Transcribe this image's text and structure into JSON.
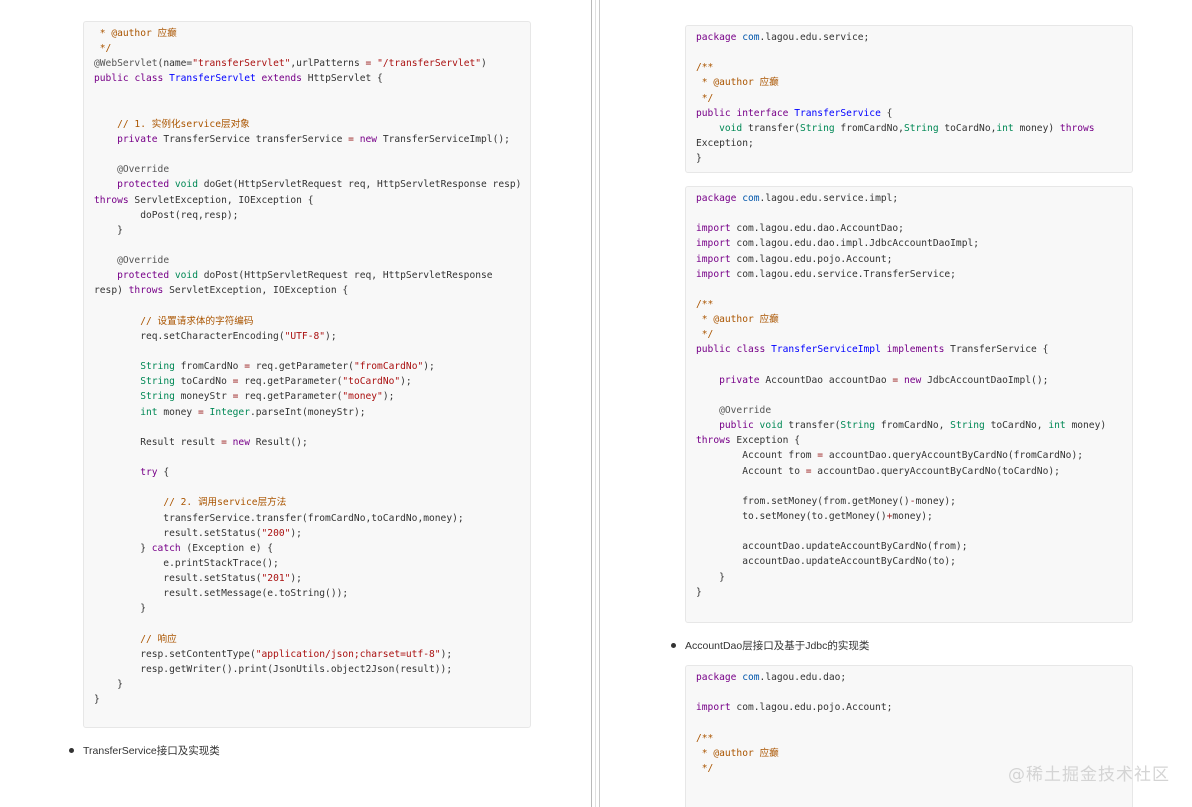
{
  "left_page": {
    "code_block": {
      "lines": [
        [
          [
            " * @author 应癫",
            "cmt"
          ]
        ],
        [
          [
            " */",
            "cmt"
          ]
        ],
        [
          [
            "@WebServlet",
            "ann"
          ],
          [
            "(name=",
            "plain"
          ],
          [
            "\"transferServlet\"",
            "str"
          ],
          [
            ",urlPatterns ",
            "plain"
          ],
          [
            "=",
            "op"
          ],
          [
            " ",
            "plain"
          ],
          [
            "\"/transferServlet\"",
            "str"
          ],
          [
            ")",
            "plain"
          ]
        ],
        [
          [
            "public",
            "kw"
          ],
          [
            " ",
            "plain"
          ],
          [
            "class",
            "kw"
          ],
          [
            " ",
            "plain"
          ],
          [
            "TransferServlet",
            "cls"
          ],
          [
            " ",
            "plain"
          ],
          [
            "extends",
            "kw"
          ],
          [
            " HttpServlet {",
            "plain"
          ]
        ],
        [
          [
            "",
            "plain"
          ]
        ],
        [
          [
            "",
            "plain"
          ]
        ],
        [
          [
            "    ",
            "plain"
          ],
          [
            "// 1. 实例化service层对象",
            "cmt"
          ]
        ],
        [
          [
            "    ",
            "plain"
          ],
          [
            "private",
            "kw"
          ],
          [
            " TransferService transferService ",
            "plain"
          ],
          [
            "=",
            "op"
          ],
          [
            " ",
            "plain"
          ],
          [
            "new",
            "kw"
          ],
          [
            " TransferServiceImpl();",
            "plain"
          ]
        ],
        [
          [
            "",
            "plain"
          ]
        ],
        [
          [
            "    ",
            "plain"
          ],
          [
            "@Override",
            "ann"
          ]
        ],
        [
          [
            "    ",
            "plain"
          ],
          [
            "protected",
            "kw"
          ],
          [
            " ",
            "plain"
          ],
          [
            "void",
            "tp"
          ],
          [
            " doGet(HttpServletRequest req, HttpServletResponse resp)",
            "plain"
          ]
        ],
        [
          [
            "throws",
            "kw"
          ],
          [
            " ServletException, IOException {",
            "plain"
          ]
        ],
        [
          [
            "        doPost(req,resp);",
            "plain"
          ]
        ],
        [
          [
            "    }",
            "plain"
          ]
        ],
        [
          [
            "",
            "plain"
          ]
        ],
        [
          [
            "    ",
            "plain"
          ],
          [
            "@Override",
            "ann"
          ]
        ],
        [
          [
            "    ",
            "plain"
          ],
          [
            "protected",
            "kw"
          ],
          [
            " ",
            "plain"
          ],
          [
            "void",
            "tp"
          ],
          [
            " doPost(HttpServletRequest req, HttpServletResponse",
            "plain"
          ]
        ],
        [
          [
            "resp) ",
            "plain"
          ],
          [
            "throws",
            "kw"
          ],
          [
            " ServletException, IOException {",
            "plain"
          ]
        ],
        [
          [
            "",
            "plain"
          ]
        ],
        [
          [
            "        ",
            "plain"
          ],
          [
            "// 设置请求体的字符编码",
            "cmt"
          ]
        ],
        [
          [
            "        req.setCharacterEncoding(",
            "plain"
          ],
          [
            "\"UTF-8\"",
            "str"
          ],
          [
            ");",
            "plain"
          ]
        ],
        [
          [
            "",
            "plain"
          ]
        ],
        [
          [
            "        ",
            "plain"
          ],
          [
            "String",
            "tp"
          ],
          [
            " fromCardNo ",
            "plain"
          ],
          [
            "=",
            "op"
          ],
          [
            " req.getParameter(",
            "plain"
          ],
          [
            "\"fromCardNo\"",
            "str"
          ],
          [
            ");",
            "plain"
          ]
        ],
        [
          [
            "        ",
            "plain"
          ],
          [
            "String",
            "tp"
          ],
          [
            " toCardNo ",
            "plain"
          ],
          [
            "=",
            "op"
          ],
          [
            " req.getParameter(",
            "plain"
          ],
          [
            "\"toCardNo\"",
            "str"
          ],
          [
            ");",
            "plain"
          ]
        ],
        [
          [
            "        ",
            "plain"
          ],
          [
            "String",
            "tp"
          ],
          [
            " moneyStr ",
            "plain"
          ],
          [
            "=",
            "op"
          ],
          [
            " req.getParameter(",
            "plain"
          ],
          [
            "\"money\"",
            "str"
          ],
          [
            ");",
            "plain"
          ]
        ],
        [
          [
            "        ",
            "plain"
          ],
          [
            "int",
            "tp"
          ],
          [
            " money ",
            "plain"
          ],
          [
            "=",
            "op"
          ],
          [
            " ",
            "plain"
          ],
          [
            "Integer",
            "tp"
          ],
          [
            ".parseInt(moneyStr);",
            "plain"
          ]
        ],
        [
          [
            "",
            "plain"
          ]
        ],
        [
          [
            "        Result result ",
            "plain"
          ],
          [
            "=",
            "op"
          ],
          [
            " ",
            "plain"
          ],
          [
            "new",
            "kw"
          ],
          [
            " Result();",
            "plain"
          ]
        ],
        [
          [
            "",
            "plain"
          ]
        ],
        [
          [
            "        ",
            "plain"
          ],
          [
            "try",
            "kw"
          ],
          [
            " {",
            "plain"
          ]
        ],
        [
          [
            "",
            "plain"
          ]
        ],
        [
          [
            "            ",
            "plain"
          ],
          [
            "// 2. 调用service层方法",
            "cmt"
          ]
        ],
        [
          [
            "            transferService.transfer(fromCardNo,toCardNo,money);",
            "plain"
          ]
        ],
        [
          [
            "            result.setStatus(",
            "plain"
          ],
          [
            "\"200\"",
            "str"
          ],
          [
            ");",
            "plain"
          ]
        ],
        [
          [
            "        } ",
            "plain"
          ],
          [
            "catch",
            "kw"
          ],
          [
            " (Exception e) {",
            "plain"
          ]
        ],
        [
          [
            "            e.printStackTrace();",
            "plain"
          ]
        ],
        [
          [
            "            result.setStatus(",
            "plain"
          ],
          [
            "\"201\"",
            "str"
          ],
          [
            ");",
            "plain"
          ]
        ],
        [
          [
            "            result.setMessage(e.toString());",
            "plain"
          ]
        ],
        [
          [
            "        }",
            "plain"
          ]
        ],
        [
          [
            "",
            "plain"
          ]
        ],
        [
          [
            "        ",
            "plain"
          ],
          [
            "// 响应",
            "cmt"
          ]
        ],
        [
          [
            "        resp.setContentType(",
            "plain"
          ],
          [
            "\"application/json;charset=utf-8\"",
            "str"
          ],
          [
            ");",
            "plain"
          ]
        ],
        [
          [
            "        resp.getWriter().print(JsonUtils.object2Json(result));",
            "plain"
          ]
        ],
        [
          [
            "    }",
            "plain"
          ]
        ],
        [
          [
            "}",
            "plain"
          ]
        ]
      ]
    },
    "bullet": "TransferService接口及实现类"
  },
  "right_page": {
    "code_block_1": {
      "lines": [
        [
          [
            "package",
            "kw"
          ],
          [
            " ",
            "plain"
          ],
          [
            "com",
            "var"
          ],
          [
            ".lagou.edu.service;",
            "plain"
          ]
        ],
        [
          [
            "",
            "plain"
          ]
        ],
        [
          [
            "/**",
            "cmt"
          ]
        ],
        [
          [
            " * @author 应癫",
            "cmt"
          ]
        ],
        [
          [
            " */",
            "cmt"
          ]
        ],
        [
          [
            "public",
            "kw"
          ],
          [
            " ",
            "plain"
          ],
          [
            "interface",
            "kw"
          ],
          [
            " ",
            "plain"
          ],
          [
            "TransferService",
            "cls"
          ],
          [
            " {",
            "plain"
          ]
        ],
        [
          [
            "    ",
            "plain"
          ],
          [
            "void",
            "tp"
          ],
          [
            " transfer(",
            "plain"
          ],
          [
            "String",
            "tp"
          ],
          [
            " fromCardNo,",
            "plain"
          ],
          [
            "String",
            "tp"
          ],
          [
            " toCardNo,",
            "plain"
          ],
          [
            "int",
            "tp"
          ],
          [
            " money) ",
            "plain"
          ],
          [
            "throws",
            "kw"
          ]
        ],
        [
          [
            "Exception;",
            "plain"
          ]
        ],
        [
          [
            "}",
            "plain"
          ]
        ]
      ]
    },
    "code_block_2": {
      "lines": [
        [
          [
            "package",
            "kw"
          ],
          [
            " ",
            "plain"
          ],
          [
            "com",
            "var"
          ],
          [
            ".lagou.edu.service.impl;",
            "plain"
          ]
        ],
        [
          [
            "",
            "plain"
          ]
        ],
        [
          [
            "import",
            "kw"
          ],
          [
            " com.lagou.edu.dao.AccountDao;",
            "plain"
          ]
        ],
        [
          [
            "import",
            "kw"
          ],
          [
            " com.lagou.edu.dao.impl.JdbcAccountDaoImpl;",
            "plain"
          ]
        ],
        [
          [
            "import",
            "kw"
          ],
          [
            " com.lagou.edu.pojo.Account;",
            "plain"
          ]
        ],
        [
          [
            "import",
            "kw"
          ],
          [
            " com.lagou.edu.service.TransferService;",
            "plain"
          ]
        ],
        [
          [
            "",
            "plain"
          ]
        ],
        [
          [
            "/**",
            "cmt"
          ]
        ],
        [
          [
            " * @author 应癫",
            "cmt"
          ]
        ],
        [
          [
            " */",
            "cmt"
          ]
        ],
        [
          [
            "public",
            "kw"
          ],
          [
            " ",
            "plain"
          ],
          [
            "class",
            "kw"
          ],
          [
            " ",
            "plain"
          ],
          [
            "TransferServiceImpl",
            "cls"
          ],
          [
            " ",
            "plain"
          ],
          [
            "implements",
            "kw"
          ],
          [
            " TransferService {",
            "plain"
          ]
        ],
        [
          [
            "",
            "plain"
          ]
        ],
        [
          [
            "    ",
            "plain"
          ],
          [
            "private",
            "kw"
          ],
          [
            " AccountDao accountDao ",
            "plain"
          ],
          [
            "=",
            "op"
          ],
          [
            " ",
            "plain"
          ],
          [
            "new",
            "kw"
          ],
          [
            " JdbcAccountDaoImpl();",
            "plain"
          ]
        ],
        [
          [
            "",
            "plain"
          ]
        ],
        [
          [
            "    ",
            "plain"
          ],
          [
            "@Override",
            "ann"
          ]
        ],
        [
          [
            "    ",
            "plain"
          ],
          [
            "public",
            "kw"
          ],
          [
            " ",
            "plain"
          ],
          [
            "void",
            "tp"
          ],
          [
            " transfer(",
            "plain"
          ],
          [
            "String",
            "tp"
          ],
          [
            " fromCardNo, ",
            "plain"
          ],
          [
            "String",
            "tp"
          ],
          [
            " toCardNo, ",
            "plain"
          ],
          [
            "int",
            "tp"
          ],
          [
            " money)",
            "plain"
          ]
        ],
        [
          [
            "throws",
            "kw"
          ],
          [
            " Exception {",
            "plain"
          ]
        ],
        [
          [
            "        Account from ",
            "plain"
          ],
          [
            "=",
            "op"
          ],
          [
            " accountDao.queryAccountByCardNo(fromCardNo);",
            "plain"
          ]
        ],
        [
          [
            "        Account to ",
            "plain"
          ],
          [
            "=",
            "op"
          ],
          [
            " accountDao.queryAccountByCardNo(toCardNo);",
            "plain"
          ]
        ],
        [
          [
            "",
            "plain"
          ]
        ],
        [
          [
            "        from.setMoney(from.getMoney()",
            "plain"
          ],
          [
            "-",
            "op"
          ],
          [
            "money);",
            "plain"
          ]
        ],
        [
          [
            "        to.setMoney(to.getMoney()",
            "plain"
          ],
          [
            "+",
            "op"
          ],
          [
            "money);",
            "plain"
          ]
        ],
        [
          [
            "",
            "plain"
          ]
        ],
        [
          [
            "        accountDao.updateAccountByCardNo(from);",
            "plain"
          ]
        ],
        [
          [
            "        accountDao.updateAccountByCardNo(to);",
            "plain"
          ]
        ],
        [
          [
            "    }",
            "plain"
          ]
        ],
        [
          [
            "}",
            "plain"
          ]
        ]
      ]
    },
    "bullet": "AccountDao层接口及基于Jdbc的实现类",
    "code_block_3": {
      "lines": [
        [
          [
            "package",
            "kw"
          ],
          [
            " ",
            "plain"
          ],
          [
            "com",
            "var"
          ],
          [
            ".lagou.edu.dao;",
            "plain"
          ]
        ],
        [
          [
            "",
            "plain"
          ]
        ],
        [
          [
            "import",
            "kw"
          ],
          [
            " com.lagou.edu.pojo.Account;",
            "plain"
          ]
        ],
        [
          [
            "",
            "plain"
          ]
        ],
        [
          [
            "/**",
            "cmt"
          ]
        ],
        [
          [
            " * @author 应癫",
            "cmt"
          ]
        ],
        [
          [
            " */",
            "cmt"
          ]
        ]
      ]
    }
  },
  "watermark": "@稀土掘金技术社区"
}
